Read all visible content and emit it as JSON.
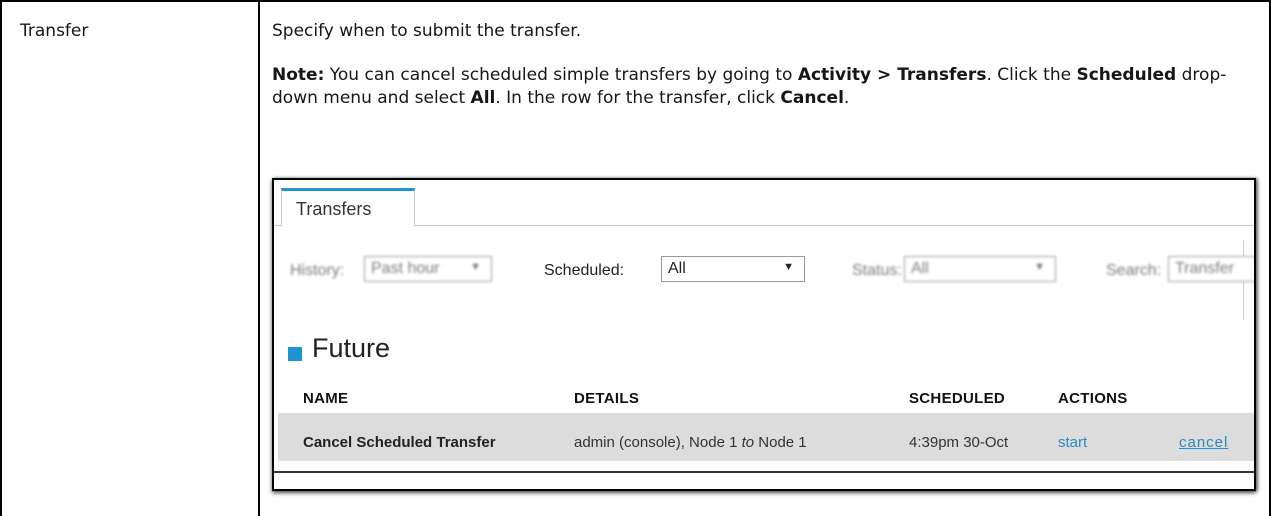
{
  "term": "Transfer",
  "description": "Specify when to submit the transfer.",
  "note": {
    "prefix": "Note:",
    "t1": " You can cancel scheduled simple transfers by going to ",
    "b1": "Activity > Transfers",
    "t2": ". Click the ",
    "b2": "Scheduled",
    "t3": " drop-down menu and select ",
    "b3": "All",
    "t4": ". In the row for the transfer, click ",
    "b4": "Cancel",
    "t5": "."
  },
  "screenshot": {
    "tab_label": "Transfers",
    "filters": {
      "history_label": "History:",
      "history_value": "Past hour",
      "scheduled_label": "Scheduled:",
      "scheduled_value": "All",
      "status_label": "Status:",
      "status_value": "All",
      "search_label": "Search:",
      "search_value": "Transfer"
    },
    "section_title": "Future",
    "columns": [
      "NAME",
      "DETAILS",
      "SCHEDULED",
      "ACTIONS"
    ],
    "row": {
      "name": "Cancel Scheduled Transfer",
      "details_a": "admin (console), Node 1 ",
      "details_to": "to",
      "details_b": " Node 1",
      "scheduled": "4:39pm 30-Oct",
      "action_start": "start",
      "action_cancel": "cancel"
    }
  },
  "colors": {
    "accent": "#1f94d0",
    "link": "#2a8ac2",
    "row_bg": "#dcdcdc"
  }
}
